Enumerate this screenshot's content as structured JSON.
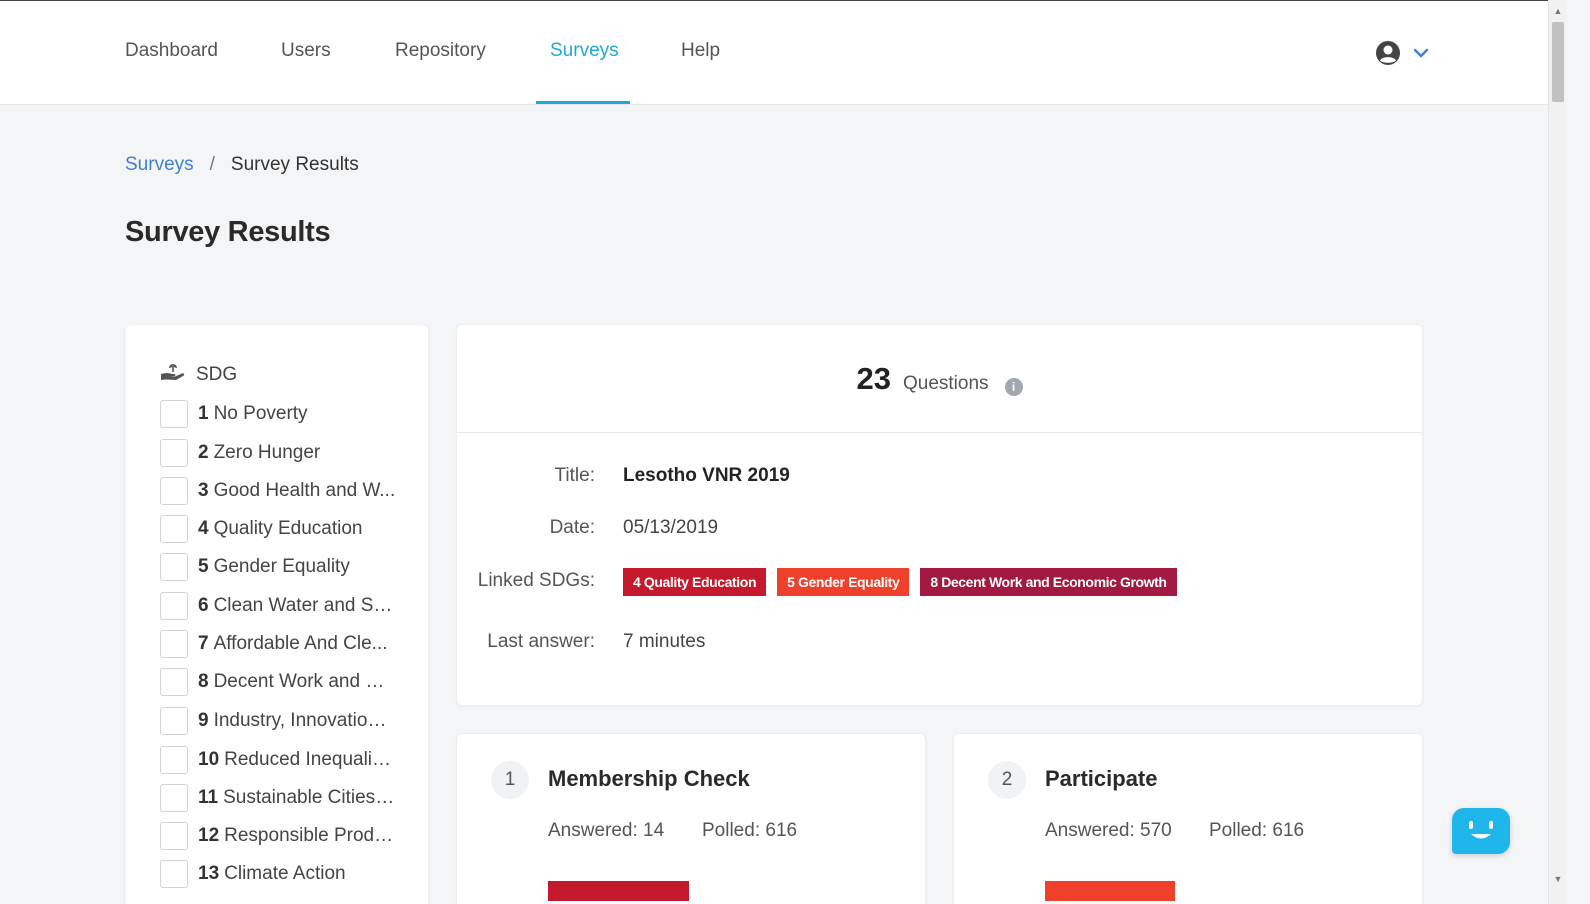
{
  "nav": {
    "items": [
      {
        "label": "Dashboard"
      },
      {
        "label": "Users"
      },
      {
        "label": "Repository"
      },
      {
        "label": "Surveys"
      },
      {
        "label": "Help"
      }
    ],
    "active": "Surveys",
    "user_icon": "user-circle-icon",
    "dropdown_icon": "chevron-down-icon"
  },
  "breadcrumb": {
    "parent": "Surveys",
    "separator": "/",
    "current": "Survey Results"
  },
  "page": {
    "title": "Survey Results"
  },
  "filter_panel": {
    "header_icon": "hand-holding-plant-icon",
    "header": "SDG",
    "items": [
      {
        "num": "1",
        "label": "No Poverty"
      },
      {
        "num": "2",
        "label": "Zero Hunger"
      },
      {
        "num": "3",
        "label": "Good Health and W..."
      },
      {
        "num": "4",
        "label": "Quality Education"
      },
      {
        "num": "5",
        "label": "Gender Equality"
      },
      {
        "num": "6",
        "label": "Clean Water and Sa..."
      },
      {
        "num": "7",
        "label": "Affordable And Cle..."
      },
      {
        "num": "8",
        "label": "Decent Work and Ec..."
      },
      {
        "num": "9",
        "label": "Industry, Innovation ..."
      },
      {
        "num": "10",
        "label": "Reduced Inequaliti..."
      },
      {
        "num": "11",
        "label": "Sustainable Cities ..."
      },
      {
        "num": "12",
        "label": "Responsible Produ..."
      },
      {
        "num": "13",
        "label": "Climate Action"
      }
    ]
  },
  "summary": {
    "question_count": "23",
    "question_label": "Questions",
    "info_icon": "info-icon",
    "title_label": "Title:",
    "title_value": "Lesotho VNR 2019",
    "date_label": "Date:",
    "date_value": "05/13/2019",
    "linked_label": "Linked SDGs:",
    "linked_sdgs": [
      {
        "label": "4 Quality Education",
        "color": "#c5192d"
      },
      {
        "label": "5 Gender Equality",
        "color": "#ef402b"
      },
      {
        "label": "8 Decent Work and Economic Growth",
        "color": "#a21942"
      }
    ],
    "last_label": "Last answer:",
    "last_value": "7 minutes"
  },
  "questions": [
    {
      "index": "1",
      "title": "Membership Check",
      "answered": "Answered: 14",
      "polled": "Polled: 616",
      "tag_color": "#c5192d"
    },
    {
      "index": "2",
      "title": "Participate",
      "answered": "Answered: 570",
      "polled": "Polled: 616",
      "tag_color": "#ef402b"
    }
  ],
  "chat": {
    "icon": "chat-bot-face-icon"
  },
  "colors": {
    "accent": "#1fa7d9",
    "link": "#3f7fd0",
    "background": "#f4f5f7"
  }
}
